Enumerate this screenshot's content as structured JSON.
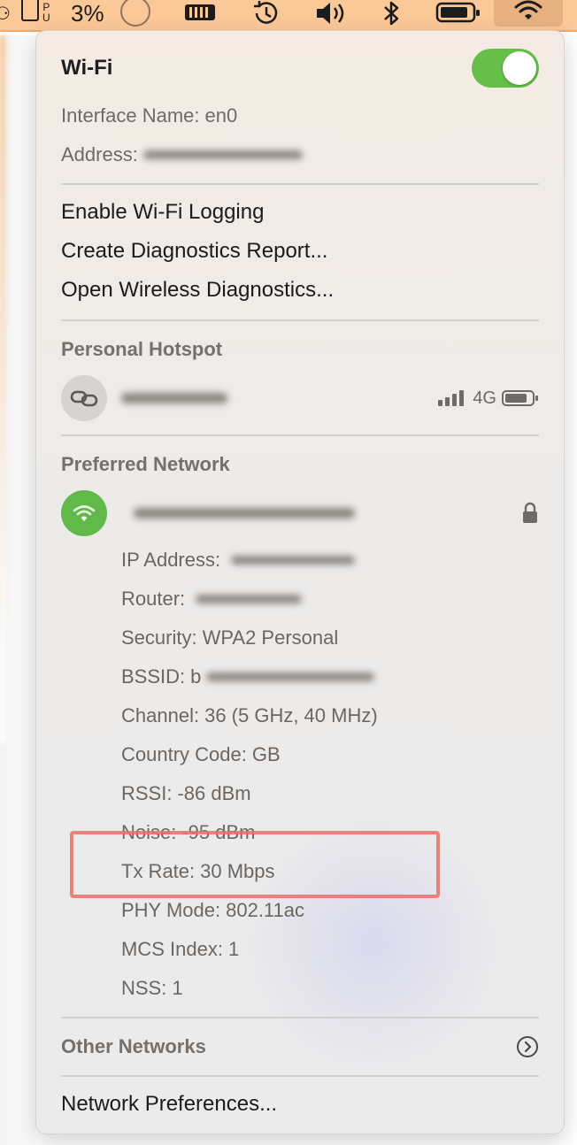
{
  "menubar": {
    "cpu_glyph": "⚆",
    "pu_label_top": "P",
    "pu_label_bottom": "U",
    "battery_percent": "3%"
  },
  "wifi": {
    "title": "Wi-Fi",
    "toggle_on": true,
    "interface_label": "Interface Name:",
    "interface_value": "en0",
    "address_label": "Address:"
  },
  "actions": [
    {
      "label": "Enable Wi-Fi Logging"
    },
    {
      "label": "Create Diagnostics Report..."
    },
    {
      "label": "Open Wireless Diagnostics..."
    }
  ],
  "hotspot": {
    "section_title": "Personal Hotspot",
    "signal_label": "4G"
  },
  "preferred": {
    "section_title": "Preferred Network",
    "details": [
      {
        "label": "IP Address:",
        "value": ""
      },
      {
        "label": "Router:",
        "value": ""
      },
      {
        "label": "Security:",
        "value": "WPA2 Personal"
      },
      {
        "label": "BSSID:",
        "value": "b"
      },
      {
        "label": "Channel:",
        "value": "36 (5 GHz, 40 MHz)"
      },
      {
        "label": "Country Code:",
        "value": "GB"
      },
      {
        "label": "RSSI:",
        "value": "-86 dBm"
      },
      {
        "label": "Noise:",
        "value": "-95 dBm"
      },
      {
        "label": "Tx Rate:",
        "value": "30 Mbps"
      },
      {
        "label": "PHY Mode:",
        "value": "802.11ac"
      },
      {
        "label": "MCS Index:",
        "value": "1"
      },
      {
        "label": "NSS:",
        "value": "1"
      }
    ]
  },
  "other_networks": {
    "label": "Other Networks"
  },
  "network_preferences": {
    "label": "Network Preferences..."
  },
  "colors": {
    "toggle_on": "#67bf4a",
    "wifi_icon_bg": "#61b94a",
    "highlight": "#e8706a",
    "menubar_bg": "#fbc898"
  }
}
